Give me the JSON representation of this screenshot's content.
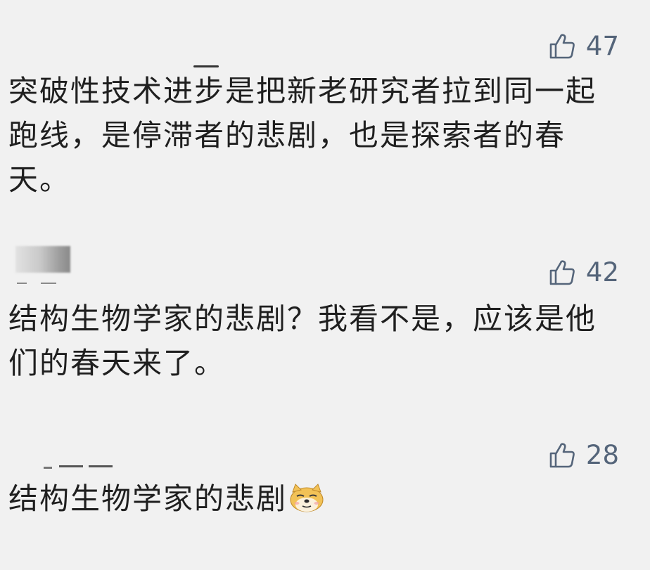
{
  "comments": [
    {
      "likes": "47",
      "text_lines": [
        "突破性技术进步是把新老研究者拉到同一起",
        "跑线，是停滞者的悲剧，也是探索者的春",
        "天。"
      ]
    },
    {
      "likes": "42",
      "text_lines": [
        "结构生物学家的悲剧？我看不是，应该是他",
        "们的春天来了。"
      ]
    },
    {
      "likes": "28",
      "text_lines": [
        "结构生物学家的悲剧"
      ],
      "emoji": "doge-face-emoji"
    }
  ],
  "icons": {
    "like": "thumbs-up-icon"
  },
  "colors": {
    "background": "#f1f1f1",
    "text": "#1f1f1f",
    "like": "#55657a"
  }
}
